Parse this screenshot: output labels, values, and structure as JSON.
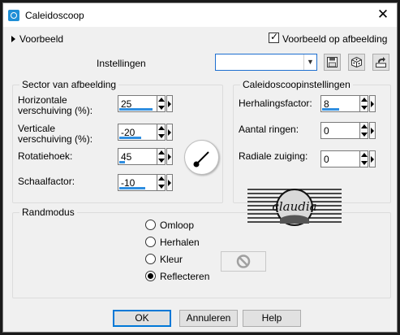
{
  "window": {
    "title": "Caleidoscoop",
    "close_glyph": "✕"
  },
  "preview": {
    "label": "Voorbeeld",
    "checkbox_label": "Voorbeeld op afbeelding",
    "checked": true
  },
  "presets": {
    "label": "Instellingen",
    "value": ""
  },
  "sector": {
    "title": "Sector van afbeelding",
    "horizontal_label_1": "Horizontale",
    "horizontal_label_2": "verschuiving (%):",
    "horizontal_value": "25",
    "vertical_label_1": "Verticale",
    "vertical_label_2": "verschuiving (%):",
    "vertical_value": "-20",
    "rotation_label": "Rotatiehoek:",
    "rotation_value": "45",
    "scale_label": "Schaalfactor:",
    "scale_value": "-10"
  },
  "kaleido": {
    "title": "Caleidoscoopinstellingen",
    "repeat_label": "Herhalingsfactor:",
    "repeat_value": "8",
    "rings_label": "Aantal ringen:",
    "rings_value": "0",
    "radial_label": "Radiale zuiging:",
    "radial_value": "0"
  },
  "edge": {
    "title": "Randmodus",
    "options": [
      "Omloop",
      "Herhalen",
      "Kleur",
      "Reflecteren"
    ],
    "selected": "Reflecteren"
  },
  "watermark_text": "claudia",
  "buttons": {
    "ok": "OK",
    "cancel": "Annuleren",
    "help": "Help"
  },
  "colors": {
    "accent": "#0078d7",
    "slider": "#2f8ee0"
  }
}
